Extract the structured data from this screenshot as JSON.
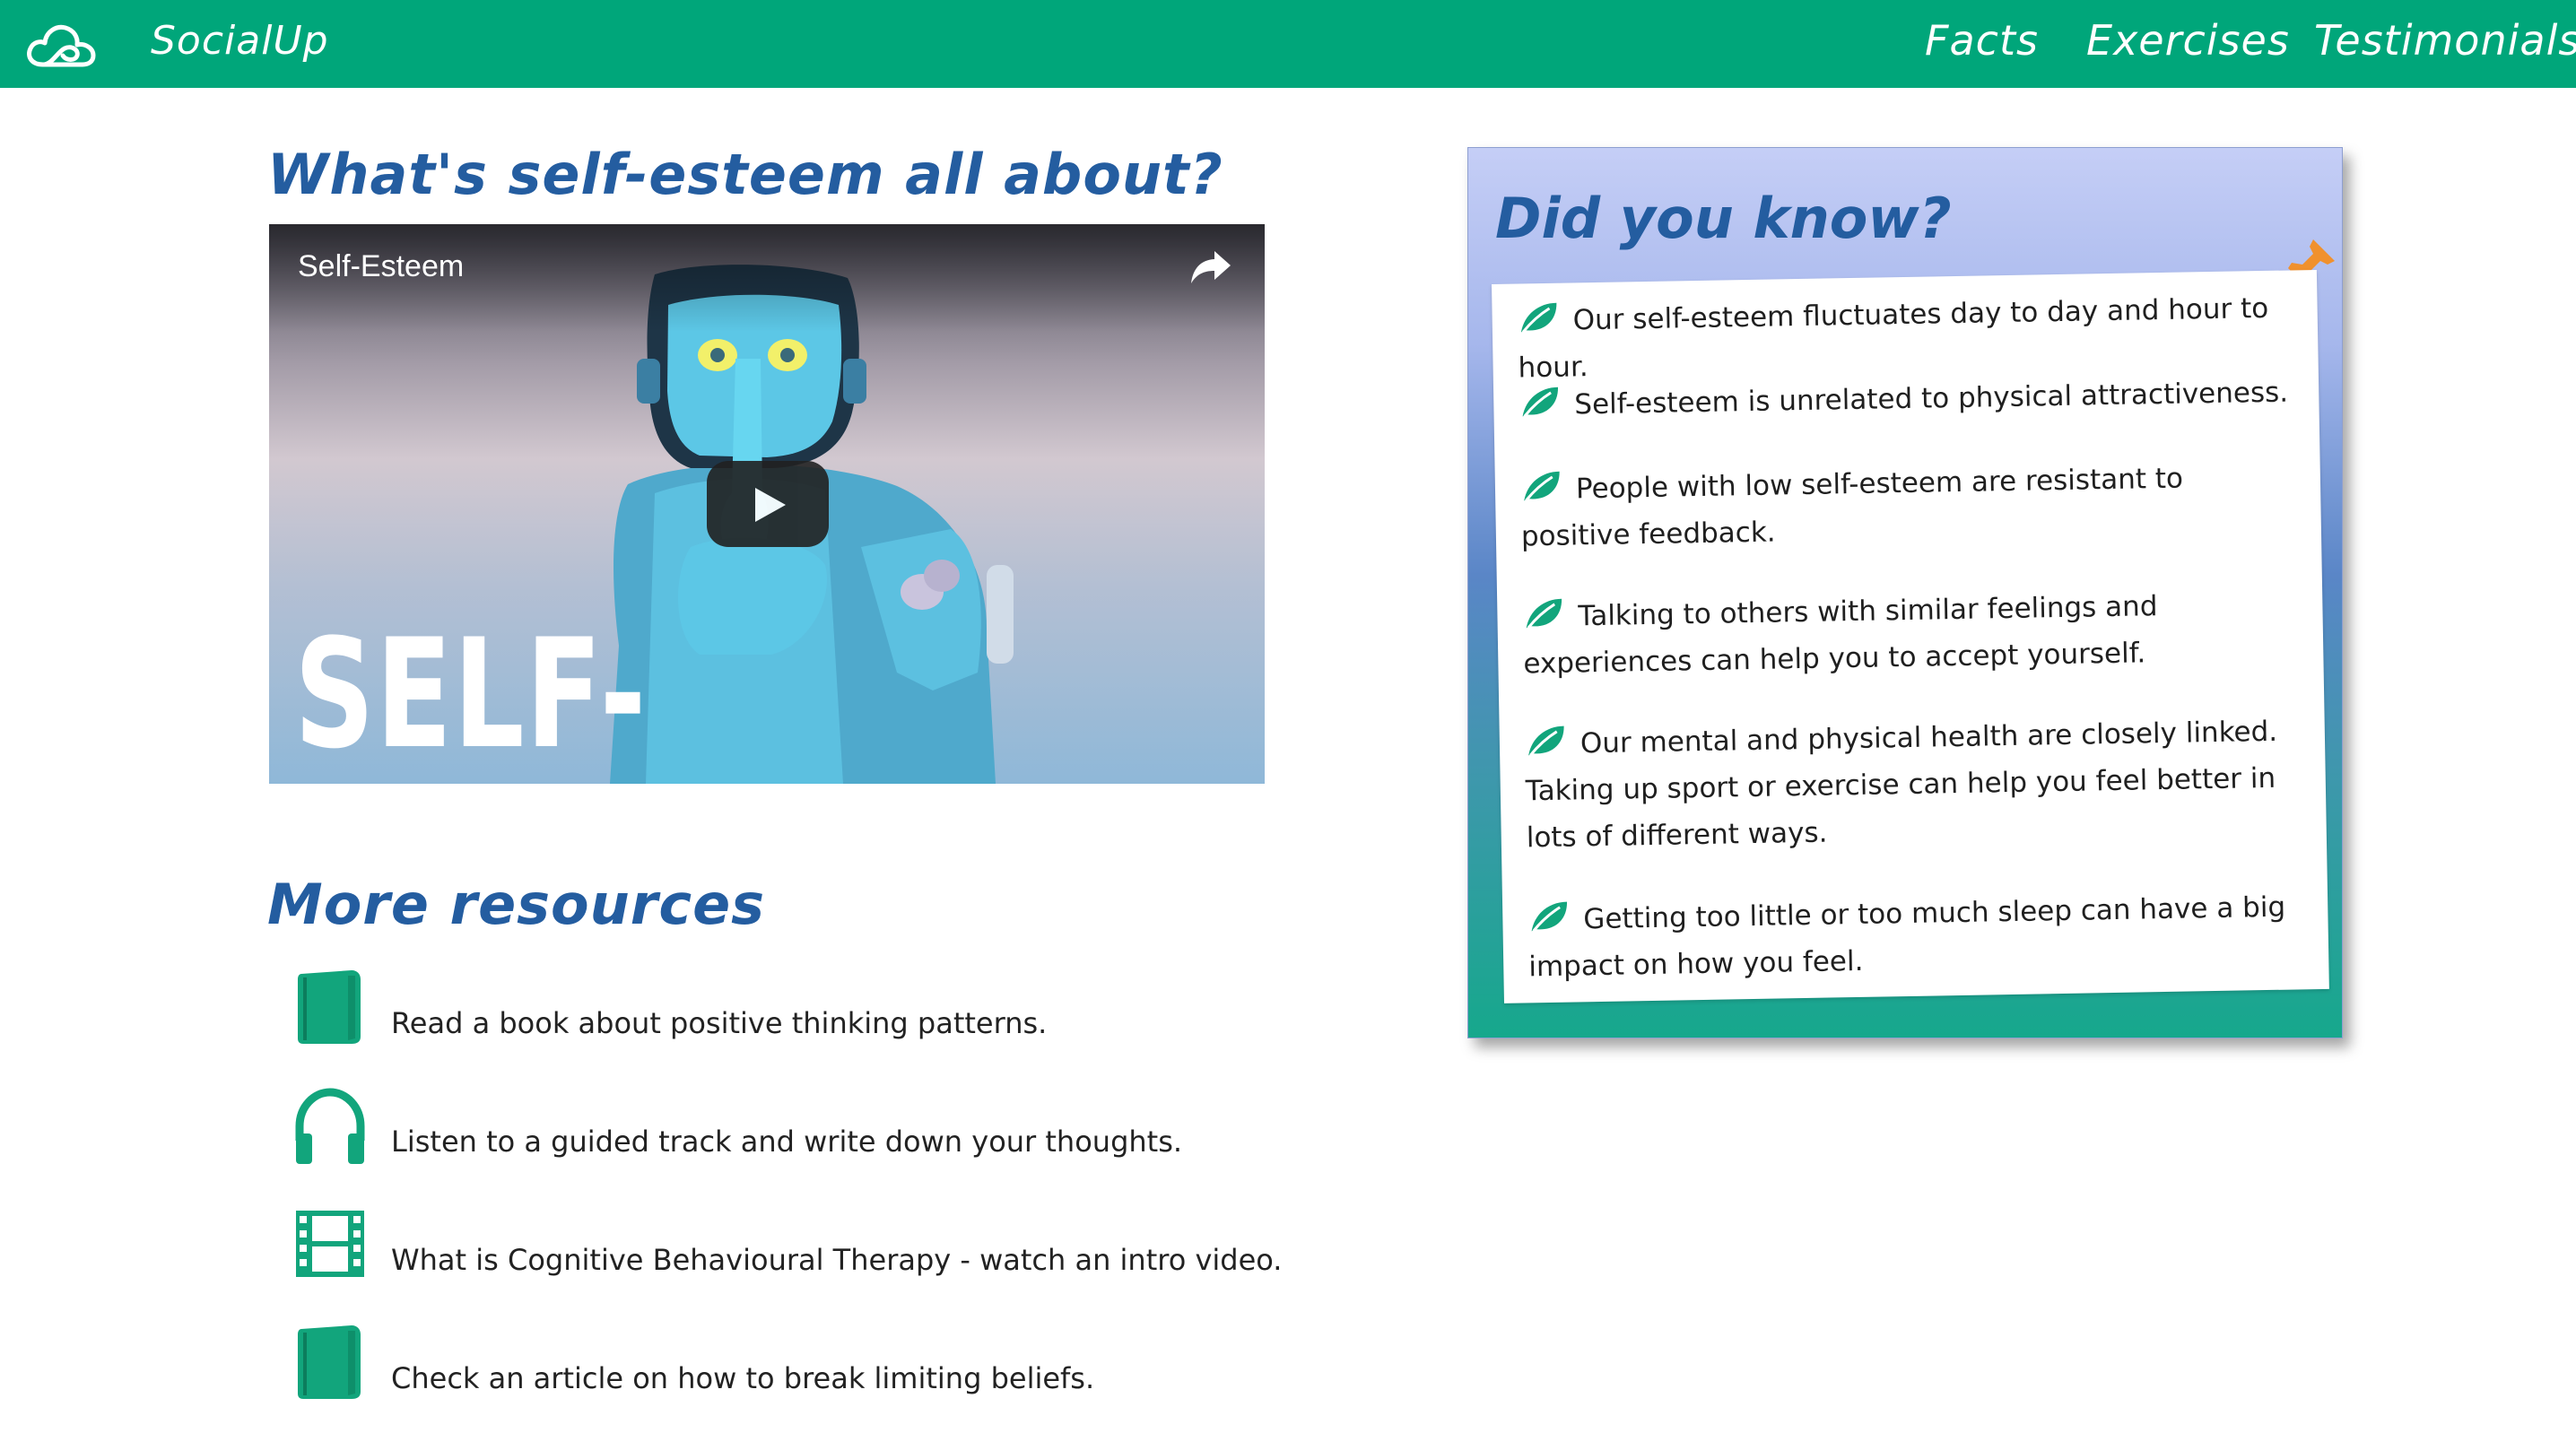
{
  "navbar": {
    "brand": "SocialUp",
    "logo_icon": "cloud-logo-icon",
    "links": [
      "Facts",
      "Exercises",
      "Testimonials"
    ],
    "background": "#00a67a"
  },
  "about": {
    "title": "What's self-esteem all about?"
  },
  "video": {
    "title": "Self-Esteem",
    "caption": "SELF-ESTEEM",
    "share_icon": "share-icon",
    "play_icon": "play-icon"
  },
  "resources": {
    "title": "More resources",
    "items": [
      {
        "icon": "book-icon",
        "text": "Read a book about positive thinking patterns."
      },
      {
        "icon": "headphones-icon",
        "text": "Listen to a guided track and write down your thoughts."
      },
      {
        "icon": "film-icon",
        "text": "What is Cognitive Behavioural Therapy - watch an intro video."
      },
      {
        "icon": "book-icon",
        "text": "Check an article on how to break limiting beliefs."
      }
    ]
  },
  "did_you_know": {
    "title": "Did you know?",
    "pin_icon": "pushpin-icon",
    "fact_icon": "leaf-icon",
    "facts": [
      "Our self-esteem fluctuates day to day and hour to hour.",
      "Self-esteem is unrelated to physical attractiveness.",
      "People with low self-esteem are resistant to positive feedback.",
      "Talking to others with similar feelings and experiences can help you to accept yourself.",
      "Our mental and physical health are closely linked. Taking up sport or exercise can help you feel better in lots of different ways.",
      "Getting too little or too much sleep can have a big impact on how you feel."
    ]
  },
  "colors": {
    "accent": "#00a67a",
    "heading": "#245da0",
    "icon": "#12a57c",
    "pin": "#f0912e"
  }
}
